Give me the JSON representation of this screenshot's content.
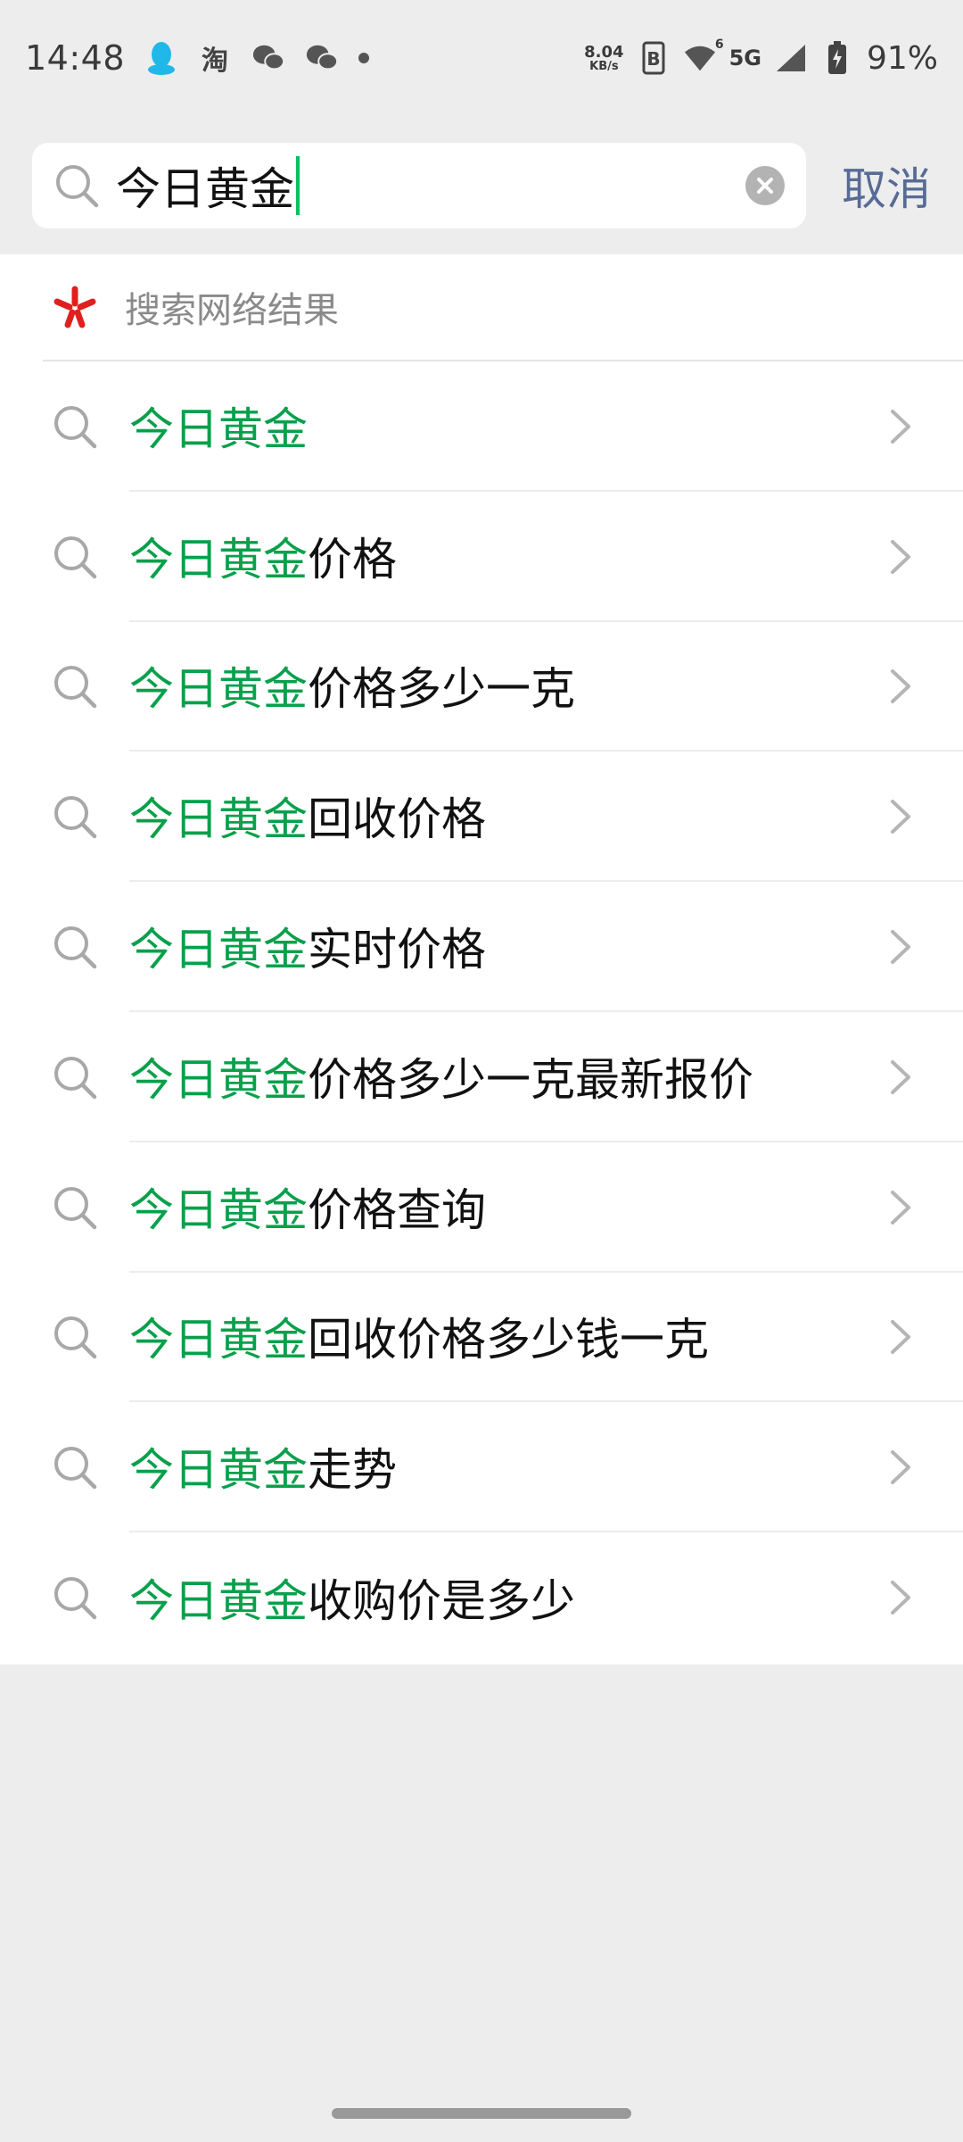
{
  "status_bar": {
    "time": "14:48",
    "taobao_label": "淘",
    "net_speed_value": "8.04",
    "net_speed_unit": "KB/s",
    "network_type": "5G",
    "wifi_superscript": "6",
    "battery": "91%",
    "icons": [
      "qq-icon",
      "taobao-icon",
      "wechat-icon",
      "wechat-icon",
      "notification-dot",
      "data-b-icon",
      "wifi-icon",
      "cell-signal-icon",
      "battery-icon"
    ]
  },
  "search": {
    "value": "今日黄金",
    "cancel_label": "取消"
  },
  "web_section": {
    "label": "搜索网络结果",
    "logo_color": "#e02020"
  },
  "suggestions": [
    {
      "highlight": "今日黄金",
      "rest": ""
    },
    {
      "highlight": "今日黄金",
      "rest": "价格"
    },
    {
      "highlight": "今日黄金",
      "rest": "价格多少一克"
    },
    {
      "highlight": "今日黄金",
      "rest": "回收价格"
    },
    {
      "highlight": "今日黄金",
      "rest": "实时价格"
    },
    {
      "highlight": "今日黄金",
      "rest": "价格多少一克最新报价"
    },
    {
      "highlight": "今日黄金",
      "rest": "价格查询"
    },
    {
      "highlight": "今日黄金",
      "rest": "回收价格多少钱一克"
    },
    {
      "highlight": "今日黄金",
      "rest": "走势"
    },
    {
      "highlight": "今日黄金",
      "rest": "收购价是多少"
    }
  ],
  "colors": {
    "highlight": "#07a04b",
    "accent_link": "#576b95",
    "caret": "#07c160"
  }
}
